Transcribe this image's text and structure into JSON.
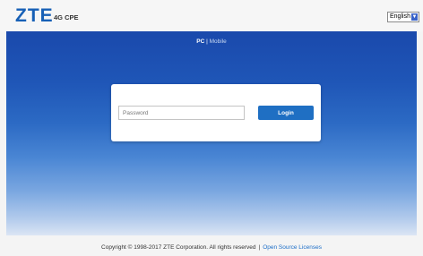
{
  "header": {
    "logo": "ZTE",
    "product": "4G CPE",
    "language": {
      "selected": "English"
    }
  },
  "view_switch": {
    "pc": "PC",
    "separator": " | ",
    "mobile": "Mobile"
  },
  "login": {
    "password_placeholder": "Password",
    "password_value": "",
    "login_label": "Login"
  },
  "footer": {
    "copyright": "Copyright © 1998-2017 ZTE Corporation. All rights reserved",
    "separator": "|",
    "license_link": "Open Source Licenses"
  },
  "colors": {
    "brand": "#1760b6",
    "button": "#1f6fc3",
    "banner_top": "#1a49ac",
    "link": "#1d6ec8"
  }
}
